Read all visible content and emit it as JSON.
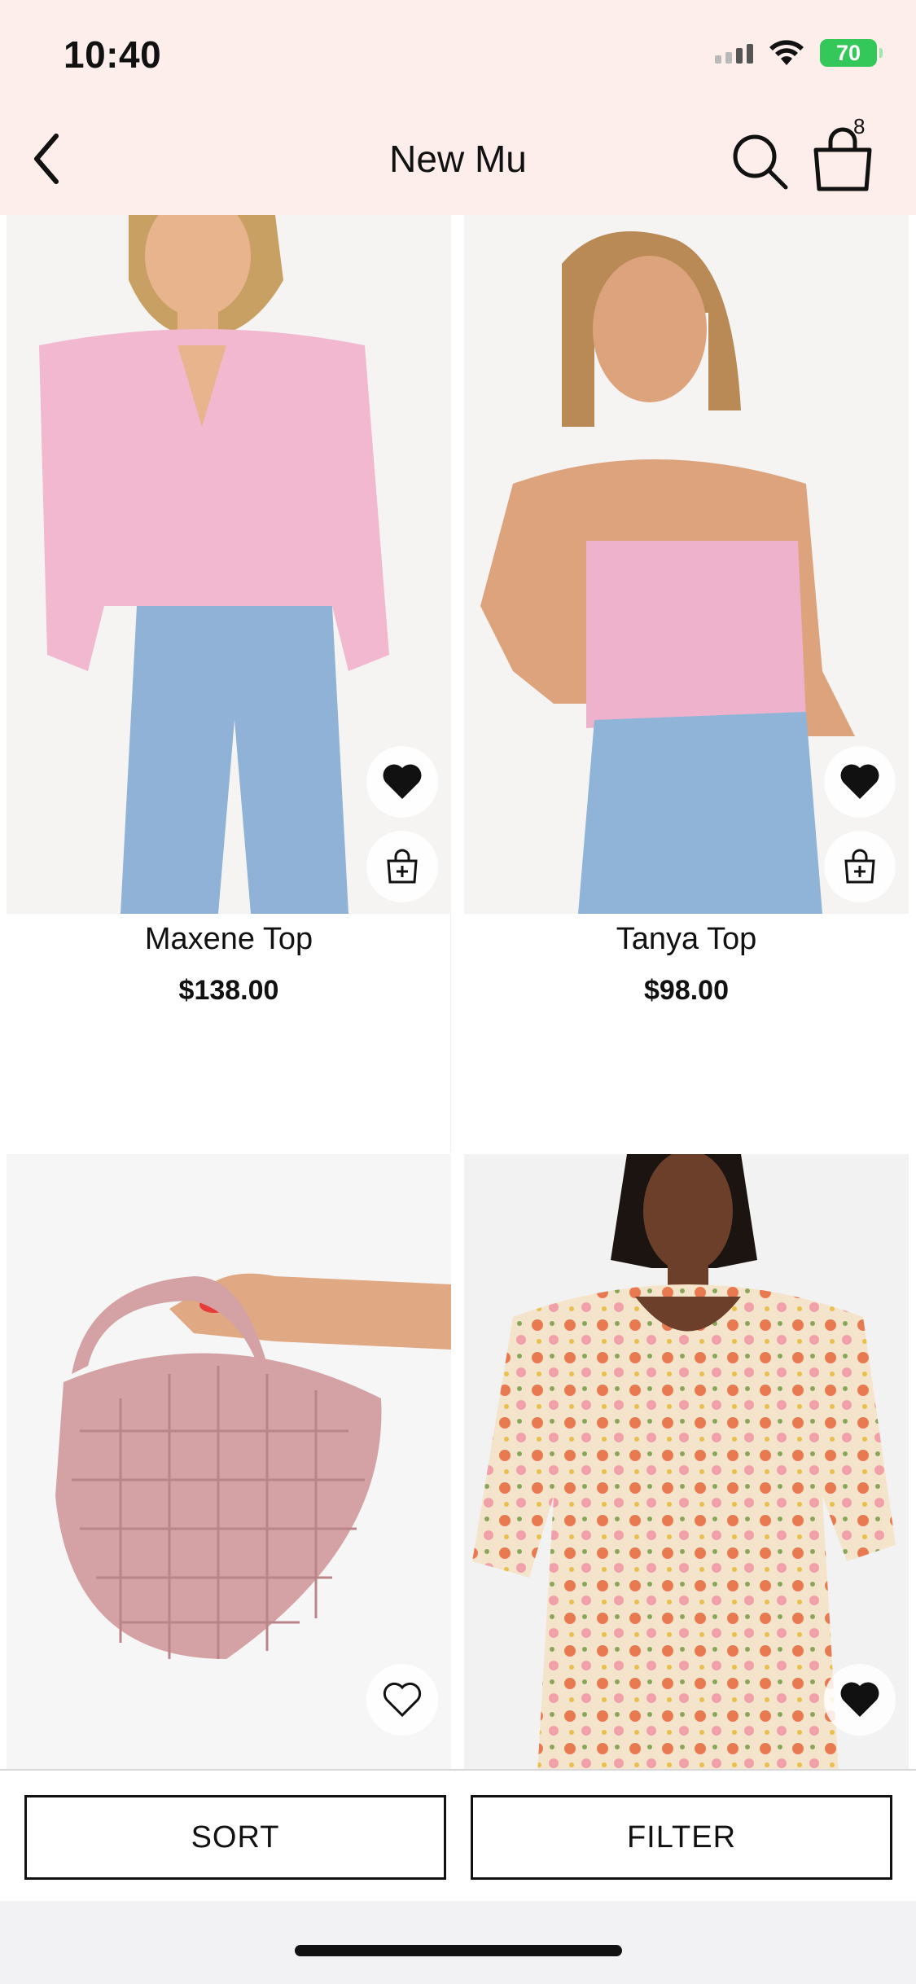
{
  "status_bar": {
    "time": "10:40",
    "battery": "70"
  },
  "header": {
    "title": "New Mu",
    "cart_count": "8"
  },
  "products": [
    {
      "name": "Maxene Top",
      "price": "$138.00",
      "favorited": true,
      "colors": {
        "top": "#f2b8cf",
        "jeans": "#8fb2d6",
        "skin": "#e8b48e",
        "hair": "#c9a064"
      }
    },
    {
      "name": "Tanya Top",
      "price": "$98.00",
      "favorited": true,
      "colors": {
        "top": "#efb2cc",
        "jeans": "#90b4d8",
        "skin": "#dca37d",
        "hair": "#b98a55"
      }
    },
    {
      "name": "",
      "price": "",
      "favorited": false,
      "colors": {
        "bag": "#d4a2a5",
        "skin": "#e0a983",
        "nails": "#e53b3b"
      }
    },
    {
      "name": "",
      "price": "",
      "favorited": true,
      "colors": {
        "dress": "#f4e4cc",
        "flowers": "#e87a52",
        "skin": "#6b3f2a",
        "hair": "#1c1410"
      }
    }
  ],
  "bottom_bar": {
    "sort_label": "SORT",
    "filter_label": "FILTER"
  }
}
